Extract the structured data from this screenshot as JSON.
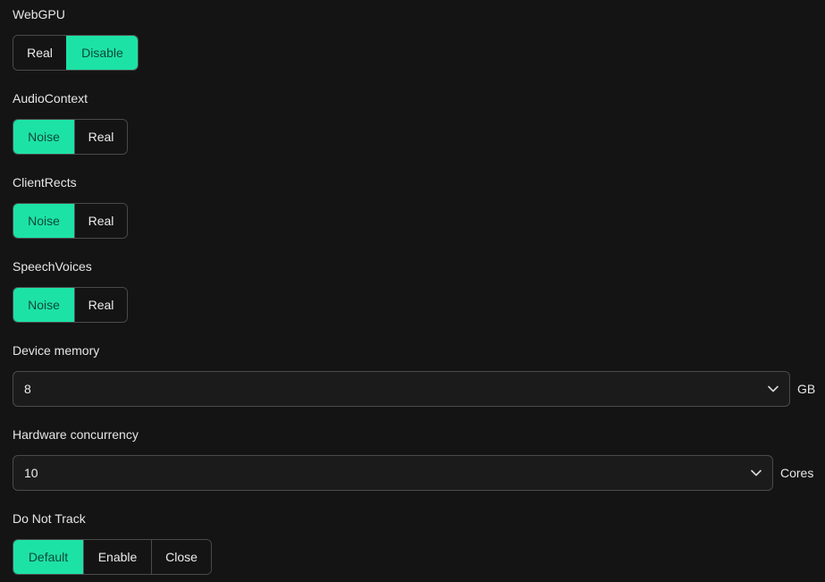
{
  "settings": {
    "webgpu": {
      "label": "WebGPU",
      "options": [
        "Real",
        "Disable"
      ],
      "selected": "Disable"
    },
    "audiocontext": {
      "label": "AudioContext",
      "options": [
        "Noise",
        "Real"
      ],
      "selected": "Noise"
    },
    "clientrects": {
      "label": "ClientRects",
      "options": [
        "Noise",
        "Real"
      ],
      "selected": "Noise"
    },
    "speechvoices": {
      "label": "SpeechVoices",
      "options": [
        "Noise",
        "Real"
      ],
      "selected": "Noise"
    },
    "device_memory": {
      "label": "Device memory",
      "value": "8",
      "unit": "GB"
    },
    "hardware_concurrency": {
      "label": "Hardware concurrency",
      "value": "10",
      "unit": "Cores"
    },
    "do_not_track": {
      "label": "Do Not Track",
      "options": [
        "Default",
        "Enable",
        "Close"
      ],
      "selected": "Default"
    }
  },
  "colors": {
    "accent": "#1de2a6",
    "accent_text": "#0f4a38",
    "background": "#141414",
    "border": "#4a4a4a"
  },
  "icons": {
    "select_arrow": "chevron-down-icon"
  }
}
